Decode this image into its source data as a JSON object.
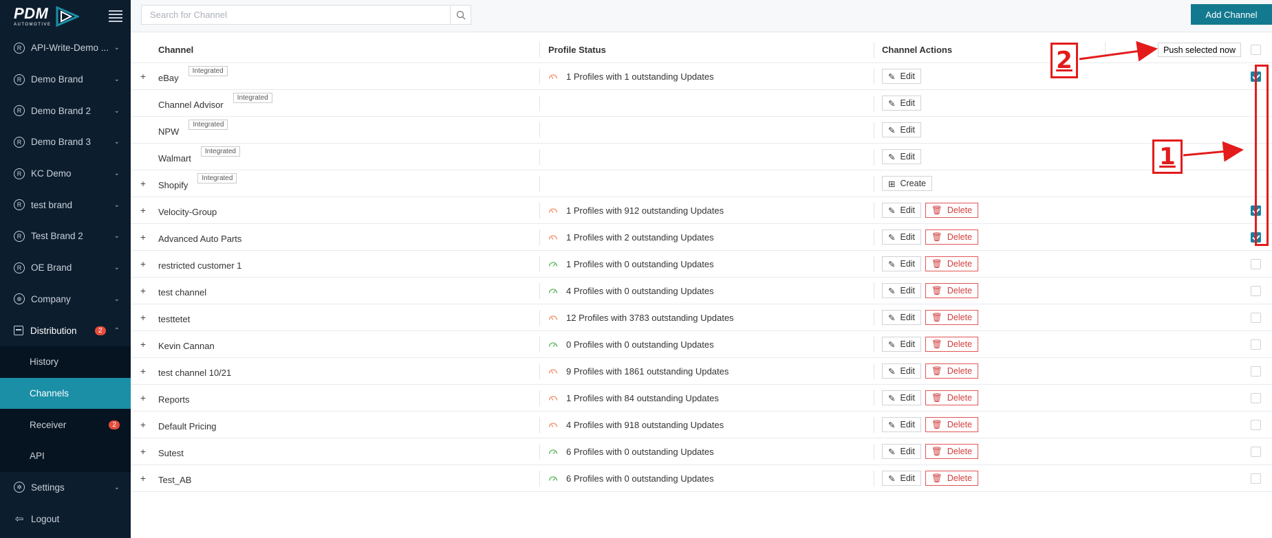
{
  "brand": {
    "logo_main": "PDM",
    "logo_sub": "AUTOMOTIVE"
  },
  "sidebar": {
    "brands": [
      {
        "label": "API-Write-Demo ..."
      },
      {
        "label": "Demo Brand"
      },
      {
        "label": "Demo Brand 2"
      },
      {
        "label": "Demo Brand 3"
      },
      {
        "label": "KC Demo"
      },
      {
        "label": "test brand"
      },
      {
        "label": "Test Brand 2"
      },
      {
        "label": "OE Brand"
      }
    ],
    "company": "Company",
    "distribution": {
      "label": "Distribution",
      "badge": "2"
    },
    "sub_items": [
      {
        "label": "History",
        "badge": ""
      },
      {
        "label": "Channels",
        "badge": ""
      },
      {
        "label": "Receiver",
        "badge": "2"
      },
      {
        "label": "API",
        "badge": ""
      }
    ],
    "settings": "Settings",
    "logout": "Logout",
    "brand_icon": "R"
  },
  "topbar": {
    "search_placeholder": "Search for Channel",
    "add_button": "Add Channel"
  },
  "table": {
    "headers": {
      "channel": "Channel",
      "status": "Profile Status",
      "actions": "Channel Actions"
    },
    "push_button": "Push selected now",
    "edit_label": "Edit",
    "delete_label": "Delete",
    "create_label": "Create",
    "integrated_label": "Integrated",
    "rows": [
      {
        "name": "eBay",
        "integrated": true,
        "expand": true,
        "status": "1 Profiles with 1 outstanding Updates",
        "status_color": "#f0926a",
        "actions": [
          "edit"
        ],
        "checked": true
      },
      {
        "name": "Channel Advisor",
        "integrated": true,
        "expand": false,
        "status": "",
        "status_color": "",
        "actions": [
          "edit"
        ],
        "checked": null
      },
      {
        "name": "NPW",
        "integrated": true,
        "expand": false,
        "status": "",
        "status_color": "",
        "actions": [
          "edit"
        ],
        "checked": null
      },
      {
        "name": "Walmart",
        "integrated": true,
        "expand": false,
        "status": "",
        "status_color": "",
        "actions": [
          "edit"
        ],
        "checked": null
      },
      {
        "name": "Shopify",
        "integrated": true,
        "expand": true,
        "status": "",
        "status_color": "",
        "actions": [
          "create"
        ],
        "checked": null
      },
      {
        "name": "Velocity-Group",
        "integrated": false,
        "expand": true,
        "status": "1 Profiles with 912 outstanding Updates",
        "status_color": "#f0926a",
        "actions": [
          "edit",
          "delete"
        ],
        "checked": true
      },
      {
        "name": "Advanced Auto Parts",
        "integrated": false,
        "expand": true,
        "status": "1 Profiles with 2 outstanding Updates",
        "status_color": "#f0926a",
        "actions": [
          "edit",
          "delete"
        ],
        "checked": true
      },
      {
        "name": "restricted customer 1",
        "integrated": false,
        "expand": true,
        "status": "1 Profiles with 0 outstanding Updates",
        "status_color": "#5cb85c",
        "actions": [
          "edit",
          "delete"
        ],
        "checked": false
      },
      {
        "name": "test channel",
        "integrated": false,
        "expand": true,
        "status": "4 Profiles with 0 outstanding Updates",
        "status_color": "#5cb85c",
        "actions": [
          "edit",
          "delete"
        ],
        "checked": false
      },
      {
        "name": "testtetet",
        "integrated": false,
        "expand": true,
        "status": "12 Profiles with 3783 outstanding Updates",
        "status_color": "#f0926a",
        "actions": [
          "edit",
          "delete"
        ],
        "checked": false
      },
      {
        "name": "Kevin Cannan",
        "integrated": false,
        "expand": true,
        "status": "0 Profiles with 0 outstanding Updates",
        "status_color": "#5cb85c",
        "actions": [
          "edit",
          "delete"
        ],
        "checked": false
      },
      {
        "name": "test channel 10/21",
        "integrated": false,
        "expand": true,
        "status": "9 Profiles with 1861 outstanding Updates",
        "status_color": "#f0926a",
        "actions": [
          "edit",
          "delete"
        ],
        "checked": false
      },
      {
        "name": "Reports",
        "integrated": false,
        "expand": true,
        "status": "1 Profiles with 84 outstanding Updates",
        "status_color": "#f0926a",
        "actions": [
          "edit",
          "delete"
        ],
        "checked": false
      },
      {
        "name": "Default Pricing",
        "integrated": false,
        "expand": true,
        "status": "4 Profiles with 918 outstanding Updates",
        "status_color": "#f0926a",
        "actions": [
          "edit",
          "delete"
        ],
        "checked": false
      },
      {
        "name": "Sutest",
        "integrated": false,
        "expand": true,
        "status": "6 Profiles with 0 outstanding Updates",
        "status_color": "#5cb85c",
        "actions": [
          "edit",
          "delete"
        ],
        "checked": false
      },
      {
        "name": "Test_AB",
        "integrated": false,
        "expand": true,
        "status": "6 Profiles with 0 outstanding Updates",
        "status_color": "#5cb85c",
        "actions": [
          "edit",
          "delete"
        ],
        "checked": false
      }
    ]
  },
  "annotations": {
    "label_1": "1",
    "label_2": "2",
    "color": "#e31b1b"
  }
}
